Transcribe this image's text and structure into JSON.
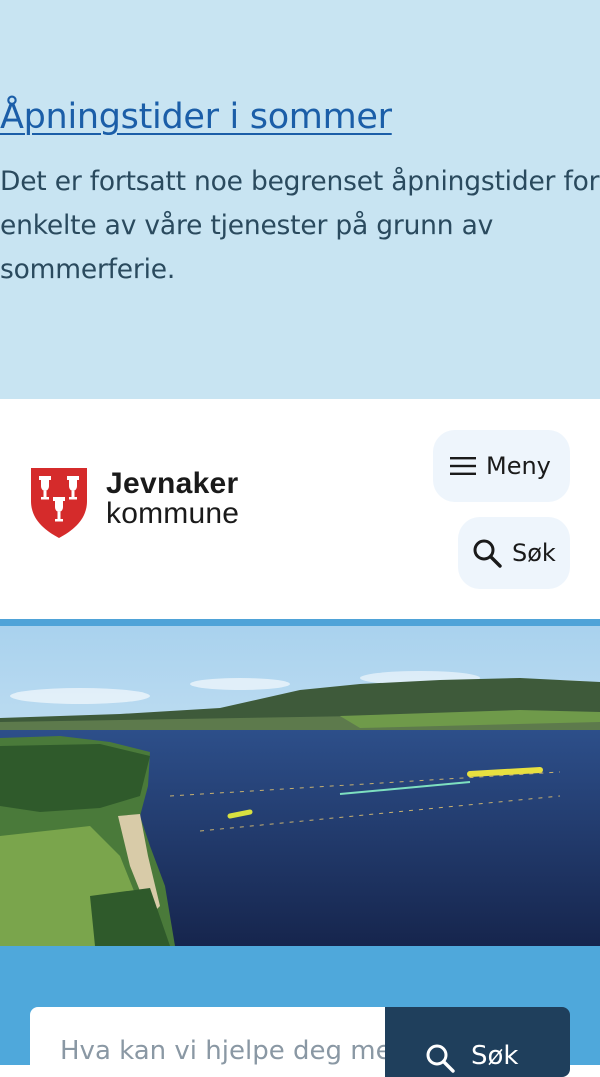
{
  "notice": {
    "title": "Åpningstider i sommer",
    "body": "Det er fortsatt noe begrenset åpningstider for enkelte av våre tjenester på grunn av sommerferie."
  },
  "header": {
    "logo_line1": "Jevnaker",
    "logo_line2": "kommune",
    "menu_label": "Meny",
    "search_label": "Søk"
  },
  "colors": {
    "notice_bg": "#c8e4f2",
    "link": "#1b5ea8",
    "shield_red": "#d52b2b",
    "accent_blue": "#4fa8db",
    "dark_navy": "#1f3f5c"
  },
  "hero": {
    "image_alt": "Flyfoto av Randsfjorden med badestrand"
  },
  "search": {
    "placeholder": "Hva kan vi hjelpe deg med?",
    "button_label": "Søk"
  }
}
